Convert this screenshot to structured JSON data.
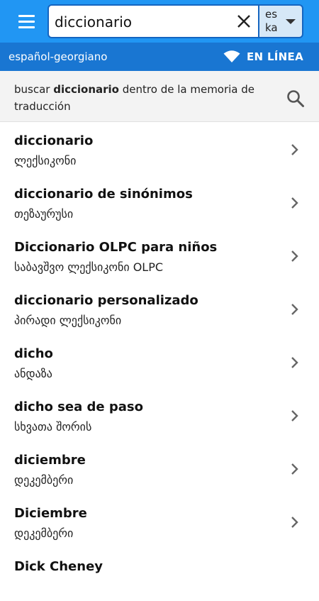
{
  "header": {
    "search_value": "diccionario",
    "lang_from": "es",
    "lang_to": "ka"
  },
  "subheader": {
    "dictionary": "español-georgiano",
    "status": "EN LÍNEA"
  },
  "tm_search": {
    "prefix": "buscar",
    "term": "diccionario",
    "suffix": "dentro de la memoria de traducción"
  },
  "results": [
    {
      "term": "diccionario",
      "translation": "ლექსიკონი"
    },
    {
      "term": "diccionario de sinónimos",
      "translation": "თეზაურუსი"
    },
    {
      "term": "Diccionario OLPC para niños",
      "translation": "საბავშვო ლექსიკონი OLPC"
    },
    {
      "term": "diccionario personalizado",
      "translation": "პირადი ლექსიკონი"
    },
    {
      "term": "dicho",
      "translation": "ანდაზა"
    },
    {
      "term": "dicho sea de paso",
      "translation": "სხვათა შორის"
    },
    {
      "term": "diciembre",
      "translation": "დეკემბერი"
    },
    {
      "term": "Diciembre",
      "translation": "დეკემბერი"
    },
    {
      "term": "Dick Cheney",
      "translation": ""
    }
  ],
  "colors": {
    "primary": "#2196f3",
    "primary_dark": "#1976d2",
    "lang_button_bg": "#d6e8f7"
  }
}
